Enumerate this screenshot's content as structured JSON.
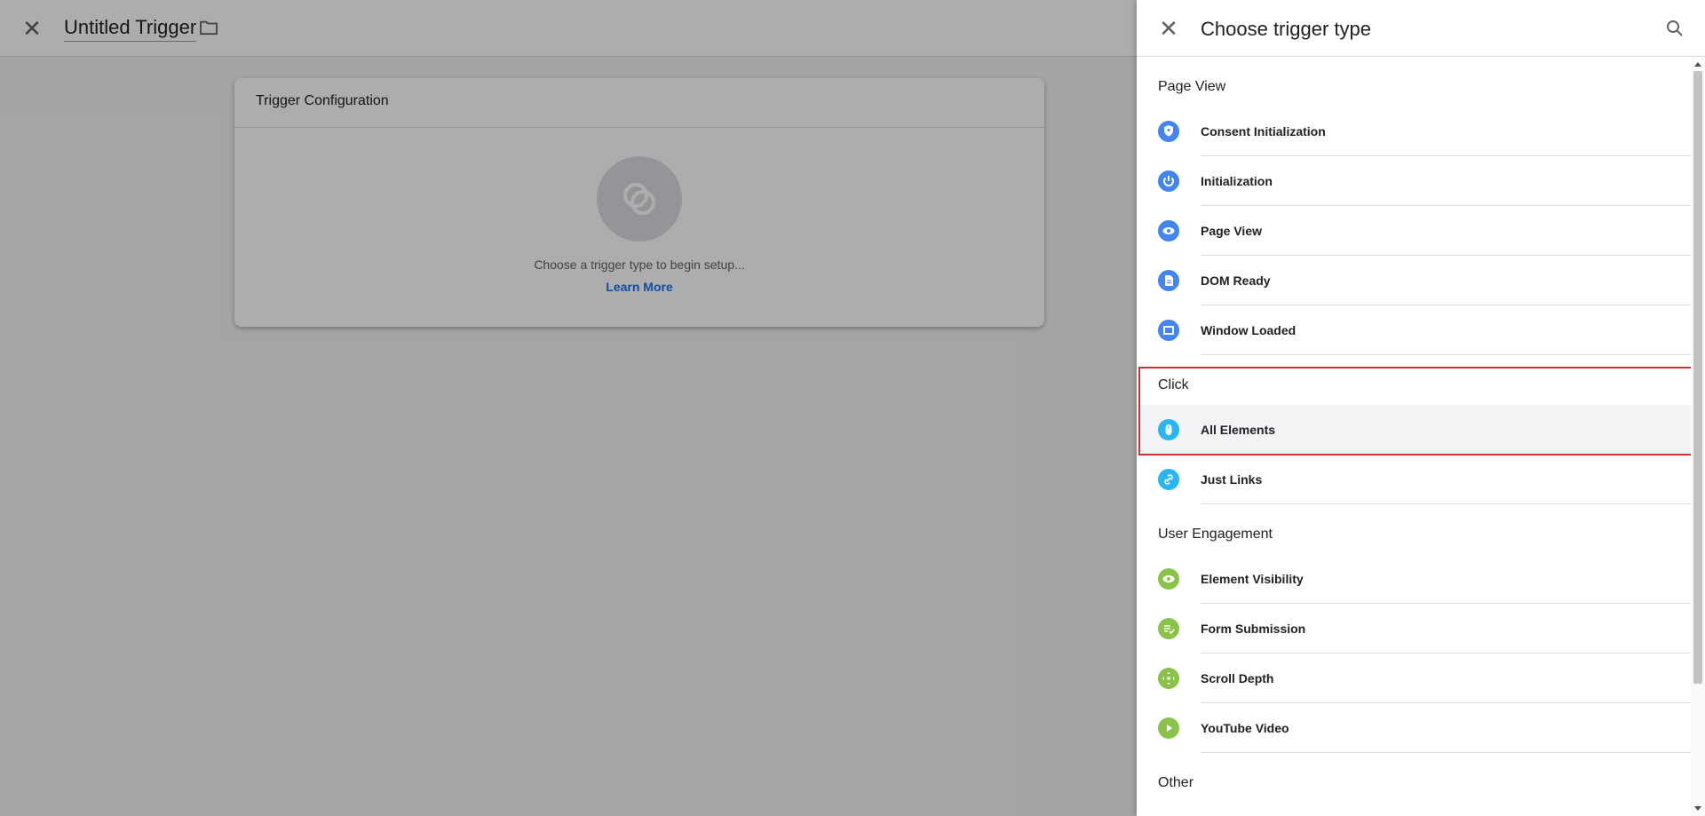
{
  "page": {
    "title": "Untitled Trigger"
  },
  "card": {
    "title": "Trigger Configuration",
    "hint": "Choose a trigger type to begin setup...",
    "learn_more": "Learn More"
  },
  "panel": {
    "title": "Choose trigger type",
    "sections": [
      {
        "title": "Page View",
        "color": "#4285f4",
        "items": [
          {
            "label": "Consent Initialization",
            "icon": "shield-icon"
          },
          {
            "label": "Initialization",
            "icon": "power-icon"
          },
          {
            "label": "Page View",
            "icon": "eye-icon"
          },
          {
            "label": "DOM Ready",
            "icon": "document-icon"
          },
          {
            "label": "Window Loaded",
            "icon": "window-icon"
          }
        ]
      },
      {
        "title": "Click",
        "color": "#29b6f6",
        "items": [
          {
            "label": "All Elements",
            "icon": "mouse-icon",
            "selected": true
          },
          {
            "label": "Just Links",
            "icon": "link-icon"
          }
        ]
      },
      {
        "title": "User Engagement",
        "color": "#8bc34a",
        "items": [
          {
            "label": "Element Visibility",
            "icon": "eye-icon"
          },
          {
            "label": "Form Submission",
            "icon": "form-check-icon"
          },
          {
            "label": "Scroll Depth",
            "icon": "move-icon"
          },
          {
            "label": "YouTube Video",
            "icon": "play-icon"
          }
        ]
      },
      {
        "title": "Other",
        "color": "#9e9e9e",
        "items": []
      }
    ]
  }
}
